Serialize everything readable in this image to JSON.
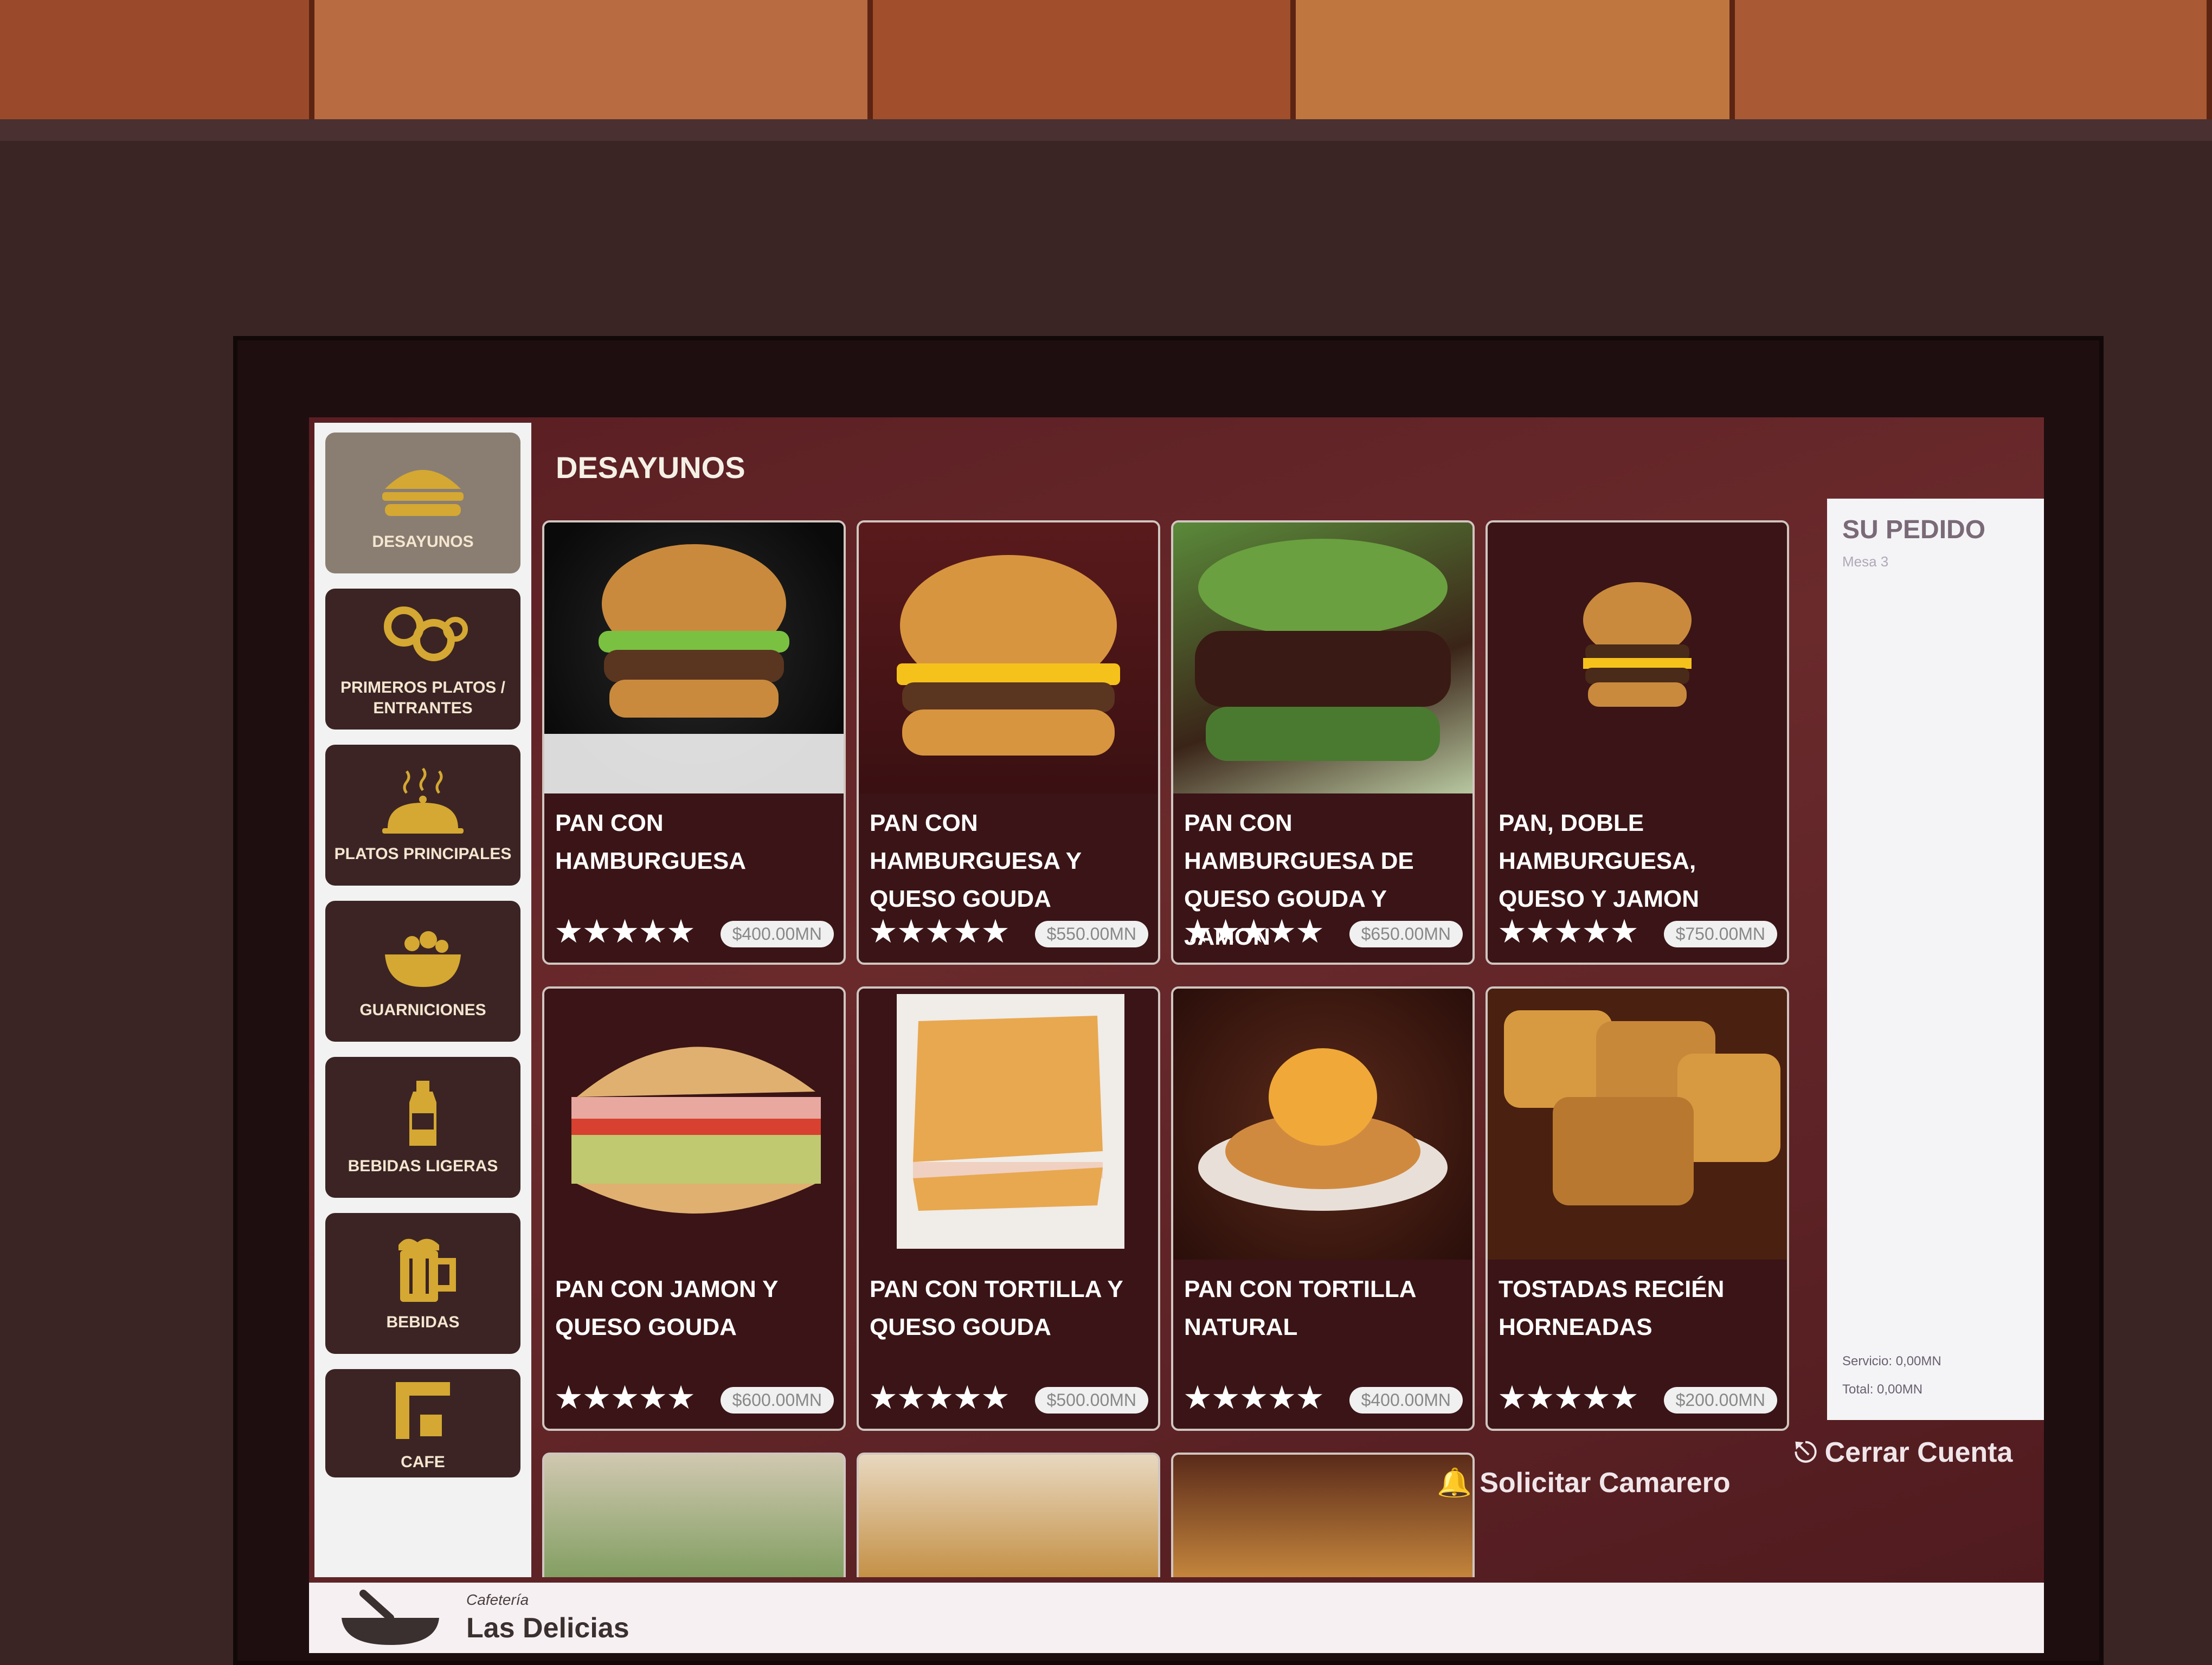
{
  "header": {
    "section_title": "DESAYUNOS"
  },
  "categories": [
    {
      "label": "DESAYUNOS",
      "icon": "burger-icon"
    },
    {
      "label": "PRIMEROS PLATOS / ENTRANTES",
      "icon": "onion-rings-icon"
    },
    {
      "label": "PLATOS PRINCIPALES",
      "icon": "cloche-icon"
    },
    {
      "label": "GUARNICIONES",
      "icon": "bowl-icon"
    },
    {
      "label": "BEBIDAS LIGERAS",
      "icon": "bottle-icon"
    },
    {
      "label": "BEBIDAS",
      "icon": "beer-mug-icon"
    },
    {
      "label": "CAFE",
      "icon": "coffee-machine-icon"
    }
  ],
  "products": [
    {
      "name": "PAN CON HAMBURGUESA",
      "price": "$400.00MN",
      "rating": 5
    },
    {
      "name": "PAN CON HAMBURGUESA Y QUESO GOUDA",
      "price": "$550.00MN",
      "rating": 5
    },
    {
      "name": "PAN CON HAMBURGUESA DE QUESO GOUDA Y JAMON",
      "price": "$650.00MN",
      "rating": 5
    },
    {
      "name": "PAN, DOBLE HAMBURGUESA, QUESO Y JAMON",
      "price": "$750.00MN",
      "rating": 5
    },
    {
      "name": "PAN CON JAMON Y QUESO GOUDA",
      "price": "$600.00MN",
      "rating": 5
    },
    {
      "name": "PAN CON TORTILLA Y QUESO GOUDA",
      "price": "$500.00MN",
      "rating": 5
    },
    {
      "name": "PAN CON TORTILLA NATURAL",
      "price": "$400.00MN",
      "rating": 5
    },
    {
      "name": "TOSTADAS RECIÉN HORNEADAS",
      "price": "$200.00MN",
      "rating": 5
    }
  ],
  "order": {
    "title": "SU PEDIDO",
    "subtitle": "Mesa 3",
    "service": "Servicio: 0,00MN",
    "total": "Total: 0,00MN"
  },
  "actions": {
    "waiter": "Solicitar Camarero",
    "close": "Cerrar Cuenta"
  },
  "footer": {
    "type": "Cafetería",
    "name": "Las Delicias"
  },
  "colors": {
    "accent_gold": "#d4a832",
    "card_bg": "#3a1416",
    "sidebar_tile": "#3c2424"
  }
}
